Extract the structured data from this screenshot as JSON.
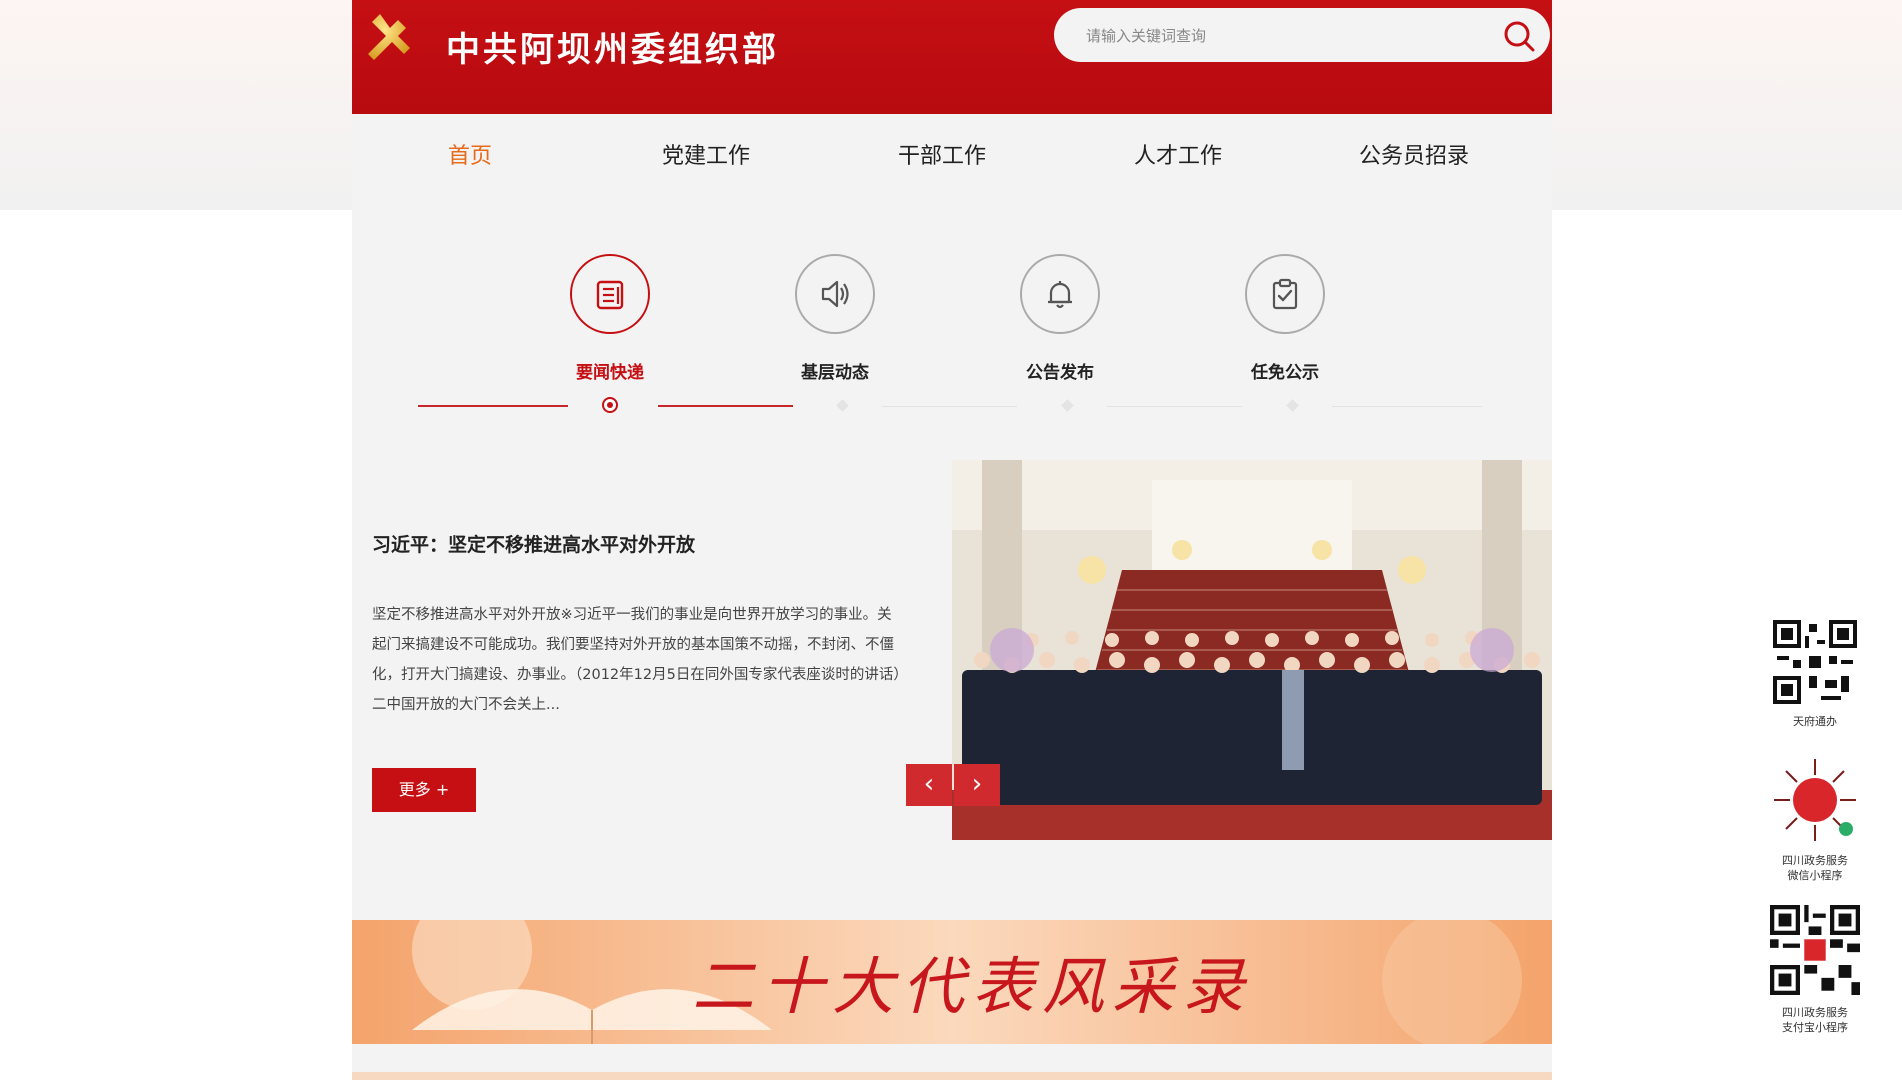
{
  "header": {
    "site_title": "中共阿坝州委组织部",
    "search_placeholder": "请输入关键词查询"
  },
  "nav": {
    "items": [
      "首页",
      "党建工作",
      "干部工作",
      "人才工作",
      "公务员招录"
    ],
    "active": "首页"
  },
  "categories": [
    {
      "label": "要闻快递",
      "icon": "news-icon",
      "active": true
    },
    {
      "label": "基层动态",
      "icon": "speaker-icon",
      "active": false
    },
    {
      "label": "公告发布",
      "icon": "bell-icon",
      "active": false
    },
    {
      "label": "任免公示",
      "icon": "clipboard-check-icon",
      "active": false
    }
  ],
  "news": {
    "title": "习近平：坚定不移推进高水平对外开放",
    "summary": "坚定不移推进高水平对外开放※习近平一我们的事业是向世界开放学习的事业。关起门来搞建设不可能成功。我们要坚持对外开放的基本国策不动摇，不封闭、不僵化，打开大门搞建设、办事业。（2012年12月5日在同外国专家代表座谈时的讲话）二中国开放的大门不会关上...",
    "more_label": "更多 +",
    "prev_label": "‹",
    "next_label": "›"
  },
  "banner": {
    "text": "二十大代表风采录"
  },
  "qr_codes": [
    {
      "label": "天府通办"
    },
    {
      "label": "四川政务服务\n微信小程序"
    },
    {
      "label": "四川政务服务\n支付宝小程序"
    }
  ],
  "colors": {
    "brand_red": "#c50f13",
    "nav_active": "#e8691a"
  }
}
